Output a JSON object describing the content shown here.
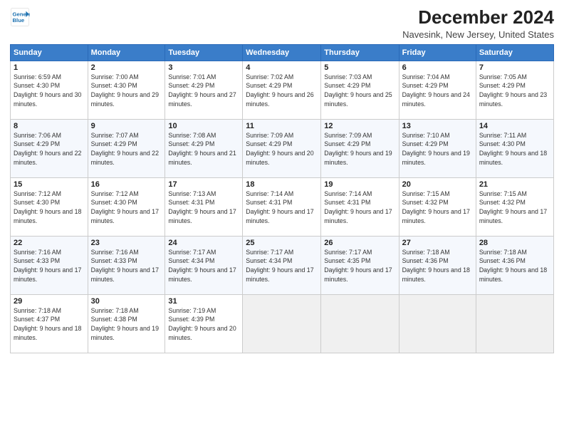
{
  "logo": {
    "line1": "General",
    "line2": "Blue"
  },
  "title": "December 2024",
  "subtitle": "Navesink, New Jersey, United States",
  "columns": [
    "Sunday",
    "Monday",
    "Tuesday",
    "Wednesday",
    "Thursday",
    "Friday",
    "Saturday"
  ],
  "weeks": [
    [
      {
        "day": "1",
        "sunrise": "6:59 AM",
        "sunset": "4:30 PM",
        "daylight": "9 hours and 30 minutes."
      },
      {
        "day": "2",
        "sunrise": "7:00 AM",
        "sunset": "4:30 PM",
        "daylight": "9 hours and 29 minutes."
      },
      {
        "day": "3",
        "sunrise": "7:01 AM",
        "sunset": "4:29 PM",
        "daylight": "9 hours and 27 minutes."
      },
      {
        "day": "4",
        "sunrise": "7:02 AM",
        "sunset": "4:29 PM",
        "daylight": "9 hours and 26 minutes."
      },
      {
        "day": "5",
        "sunrise": "7:03 AM",
        "sunset": "4:29 PM",
        "daylight": "9 hours and 25 minutes."
      },
      {
        "day": "6",
        "sunrise": "7:04 AM",
        "sunset": "4:29 PM",
        "daylight": "9 hours and 24 minutes."
      },
      {
        "day": "7",
        "sunrise": "7:05 AM",
        "sunset": "4:29 PM",
        "daylight": "9 hours and 23 minutes."
      }
    ],
    [
      {
        "day": "8",
        "sunrise": "7:06 AM",
        "sunset": "4:29 PM",
        "daylight": "9 hours and 22 minutes."
      },
      {
        "day": "9",
        "sunrise": "7:07 AM",
        "sunset": "4:29 PM",
        "daylight": "9 hours and 22 minutes."
      },
      {
        "day": "10",
        "sunrise": "7:08 AM",
        "sunset": "4:29 PM",
        "daylight": "9 hours and 21 minutes."
      },
      {
        "day": "11",
        "sunrise": "7:09 AM",
        "sunset": "4:29 PM",
        "daylight": "9 hours and 20 minutes."
      },
      {
        "day": "12",
        "sunrise": "7:09 AM",
        "sunset": "4:29 PM",
        "daylight": "9 hours and 19 minutes."
      },
      {
        "day": "13",
        "sunrise": "7:10 AM",
        "sunset": "4:29 PM",
        "daylight": "9 hours and 19 minutes."
      },
      {
        "day": "14",
        "sunrise": "7:11 AM",
        "sunset": "4:30 PM",
        "daylight": "9 hours and 18 minutes."
      }
    ],
    [
      {
        "day": "15",
        "sunrise": "7:12 AM",
        "sunset": "4:30 PM",
        "daylight": "9 hours and 18 minutes."
      },
      {
        "day": "16",
        "sunrise": "7:12 AM",
        "sunset": "4:30 PM",
        "daylight": "9 hours and 17 minutes."
      },
      {
        "day": "17",
        "sunrise": "7:13 AM",
        "sunset": "4:31 PM",
        "daylight": "9 hours and 17 minutes."
      },
      {
        "day": "18",
        "sunrise": "7:14 AM",
        "sunset": "4:31 PM",
        "daylight": "9 hours and 17 minutes."
      },
      {
        "day": "19",
        "sunrise": "7:14 AM",
        "sunset": "4:31 PM",
        "daylight": "9 hours and 17 minutes."
      },
      {
        "day": "20",
        "sunrise": "7:15 AM",
        "sunset": "4:32 PM",
        "daylight": "9 hours and 17 minutes."
      },
      {
        "day": "21",
        "sunrise": "7:15 AM",
        "sunset": "4:32 PM",
        "daylight": "9 hours and 17 minutes."
      }
    ],
    [
      {
        "day": "22",
        "sunrise": "7:16 AM",
        "sunset": "4:33 PM",
        "daylight": "9 hours and 17 minutes."
      },
      {
        "day": "23",
        "sunrise": "7:16 AM",
        "sunset": "4:33 PM",
        "daylight": "9 hours and 17 minutes."
      },
      {
        "day": "24",
        "sunrise": "7:17 AM",
        "sunset": "4:34 PM",
        "daylight": "9 hours and 17 minutes."
      },
      {
        "day": "25",
        "sunrise": "7:17 AM",
        "sunset": "4:34 PM",
        "daylight": "9 hours and 17 minutes."
      },
      {
        "day": "26",
        "sunrise": "7:17 AM",
        "sunset": "4:35 PM",
        "daylight": "9 hours and 17 minutes."
      },
      {
        "day": "27",
        "sunrise": "7:18 AM",
        "sunset": "4:36 PM",
        "daylight": "9 hours and 18 minutes."
      },
      {
        "day": "28",
        "sunrise": "7:18 AM",
        "sunset": "4:36 PM",
        "daylight": "9 hours and 18 minutes."
      }
    ],
    [
      {
        "day": "29",
        "sunrise": "7:18 AM",
        "sunset": "4:37 PM",
        "daylight": "9 hours and 18 minutes."
      },
      {
        "day": "30",
        "sunrise": "7:18 AM",
        "sunset": "4:38 PM",
        "daylight": "9 hours and 19 minutes."
      },
      {
        "day": "31",
        "sunrise": "7:19 AM",
        "sunset": "4:39 PM",
        "daylight": "9 hours and 20 minutes."
      },
      null,
      null,
      null,
      null
    ]
  ]
}
